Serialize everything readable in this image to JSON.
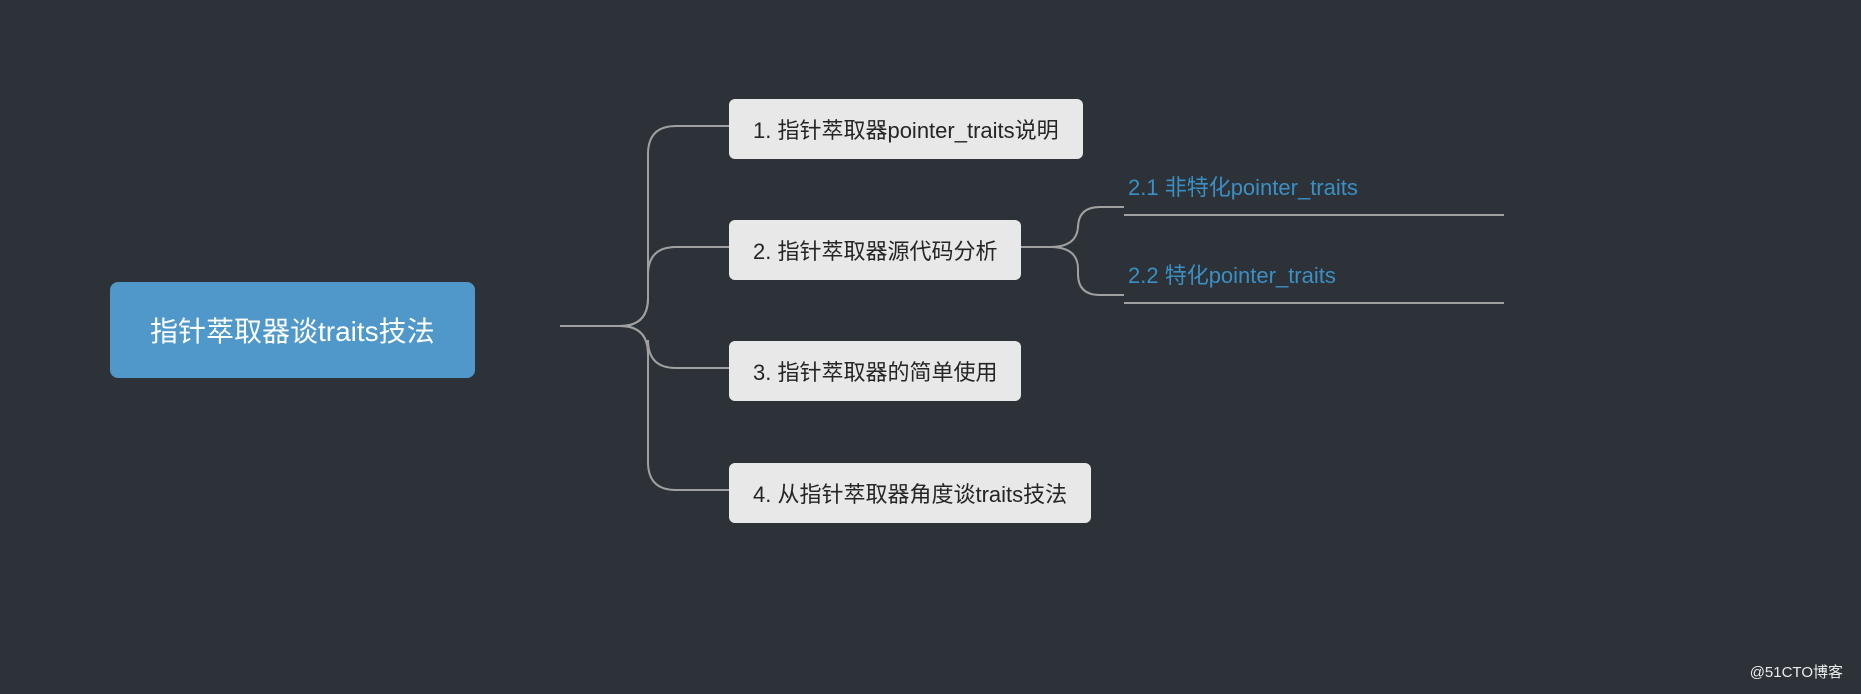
{
  "root": {
    "title": "指针萃取器谈traits技法"
  },
  "children": {
    "c1": "1. 指针萃取器pointer_traits说明",
    "c2": "2. 指针萃取器源代码分析",
    "c3": "3. 指针萃取器的简单使用",
    "c4": "4. 从指针萃取器角度谈traits技法"
  },
  "leaves": {
    "l1": "2.1 非特化pointer_traits",
    "l2": "2.2 特化pointer_traits"
  },
  "watermark": "@51CTO博客"
}
